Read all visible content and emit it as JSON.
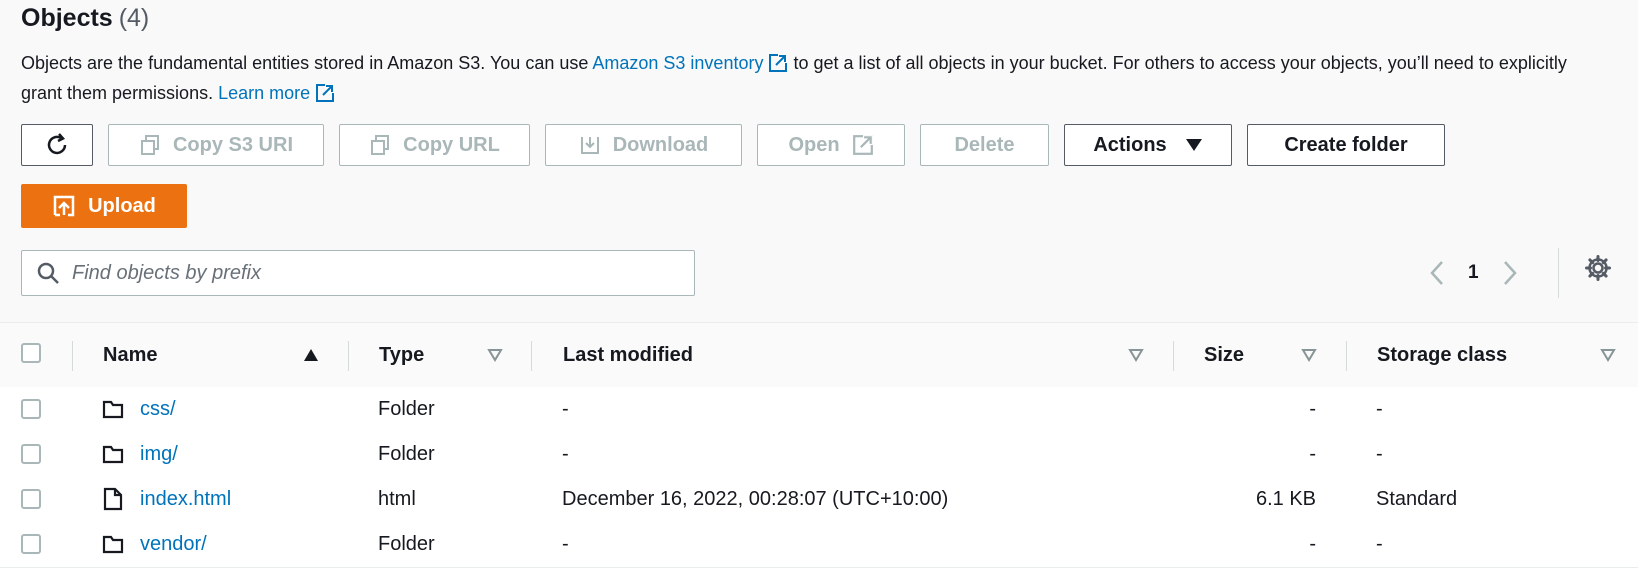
{
  "header": {
    "title": "Objects",
    "count": "(4)",
    "desc_part1": "Objects are the fundamental entities stored in Amazon S3. You can use ",
    "inventory_link": "Amazon S3 inventory",
    "desc_part2": " to get a list of all objects in your bucket. For others to access your objects, you’ll need to explicitly grant them permissions. ",
    "learn_more": "Learn more"
  },
  "toolbar": {
    "copy_s3_uri": "Copy S3 URI",
    "copy_url": "Copy URL",
    "download": "Download",
    "open": "Open",
    "delete": "Delete",
    "actions": "Actions",
    "create_folder": "Create folder",
    "upload": "Upload"
  },
  "search": {
    "placeholder": "Find objects by prefix",
    "value": ""
  },
  "pagination": {
    "current_page": "1"
  },
  "table": {
    "headers": {
      "name": "Name",
      "type": "Type",
      "last_modified": "Last modified",
      "size": "Size",
      "storage_class": "Storage class"
    },
    "rows": [
      {
        "name": "css/",
        "icon": "folder-icon",
        "type": "Folder",
        "last_modified": "-",
        "size": "-",
        "storage_class": "-"
      },
      {
        "name": "img/",
        "icon": "folder-icon",
        "type": "Folder",
        "last_modified": "-",
        "size": "-",
        "storage_class": "-"
      },
      {
        "name": "index.html",
        "icon": "file-icon",
        "type": "html",
        "last_modified": "December 16, 2022, 00:28:07 (UTC+10:00)",
        "size": "6.1 KB",
        "storage_class": "Standard"
      },
      {
        "name": "vendor/",
        "icon": "folder-icon",
        "type": "Folder",
        "last_modified": "-",
        "size": "-",
        "storage_class": "-"
      }
    ]
  },
  "colors": {
    "link": "#0073bb",
    "primary": "#ec7211",
    "disabled": "#aab7b8",
    "text": "#16191f"
  }
}
